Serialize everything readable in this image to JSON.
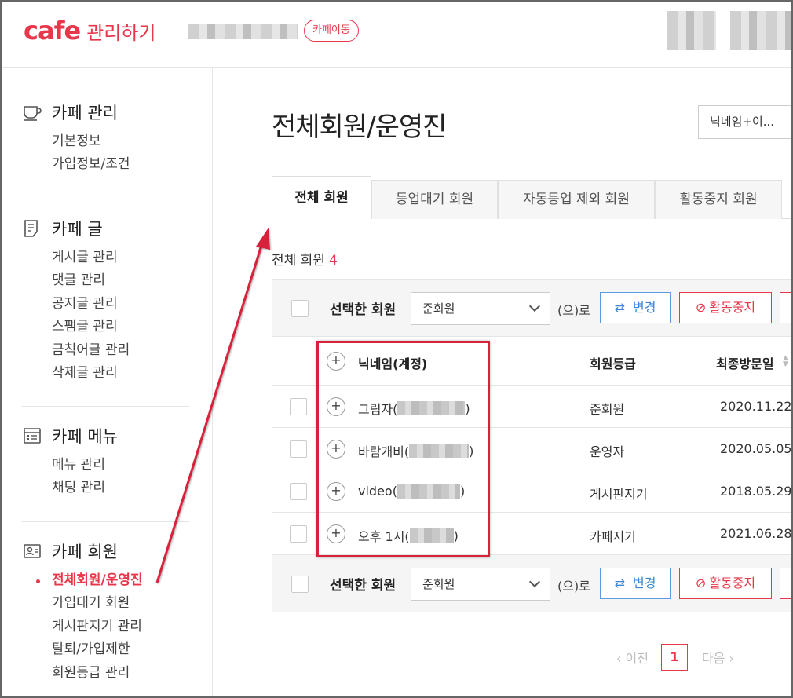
{
  "header": {
    "logo_cafe": "cafe",
    "logo_text": "관리하기",
    "cafe_move_label": "카페이동"
  },
  "sidebar": {
    "sections": [
      {
        "title": "카페 관리",
        "icon": "cup-icon",
        "items": [
          "기본정보",
          "가입정보/조건"
        ]
      },
      {
        "title": "카페 글",
        "icon": "document-icon",
        "items": [
          "게시글 관리",
          "댓글 관리",
          "공지글 관리",
          "스팸글 관리",
          "금칙어글 관리",
          "삭제글 관리"
        ]
      },
      {
        "title": "카페 메뉴",
        "icon": "menu-list-icon",
        "items": [
          "메뉴 관리",
          "채팅 관리"
        ]
      },
      {
        "title": "카페 회원",
        "icon": "member-card-icon",
        "items": [
          "전체회원/운영진",
          "가입대기 회원",
          "게시판지기 관리",
          "탈퇴/가입제한",
          "회원등급 관리"
        ]
      }
    ],
    "active_item": "전체회원/운영진"
  },
  "main": {
    "title": "전체회원/운영진",
    "filter_select": "닉네임+이...",
    "tabs": [
      "전체 회원",
      "등업대기 회원",
      "자동등업 제외 회원",
      "활동중지 회원"
    ],
    "count_label": "전체 회원",
    "count_value": "4",
    "action_bar": {
      "label": "선택한 회원",
      "grade_value": "준회원",
      "ro_text": "(으)로",
      "change_label": "변경",
      "stop_label": "활동중지"
    },
    "table": {
      "headers": [
        "닉네임(계정)",
        "회원등급",
        "최종방문일"
      ],
      "rows": [
        {
          "nick": "그림자(",
          "nick_end": ")",
          "grade": "준회원",
          "last_visit": "2020.11.22"
        },
        {
          "nick": "바람개비(",
          "nick_end": ")",
          "grade": "운영자",
          "last_visit": "2020.05.05"
        },
        {
          "nick": "video(",
          "nick_end": ")",
          "grade": "게시판지기",
          "last_visit": "2018.05.29"
        },
        {
          "nick": "오후 1시(",
          "nick_end": ")",
          "grade": "카페지기",
          "last_visit": "2021.06.28"
        }
      ]
    },
    "pager": {
      "prev": "이전",
      "current": "1",
      "next": "다음"
    }
  },
  "colors": {
    "accent": "#e8364a",
    "blue": "#3b85d9",
    "annotation": "#d8213b"
  }
}
